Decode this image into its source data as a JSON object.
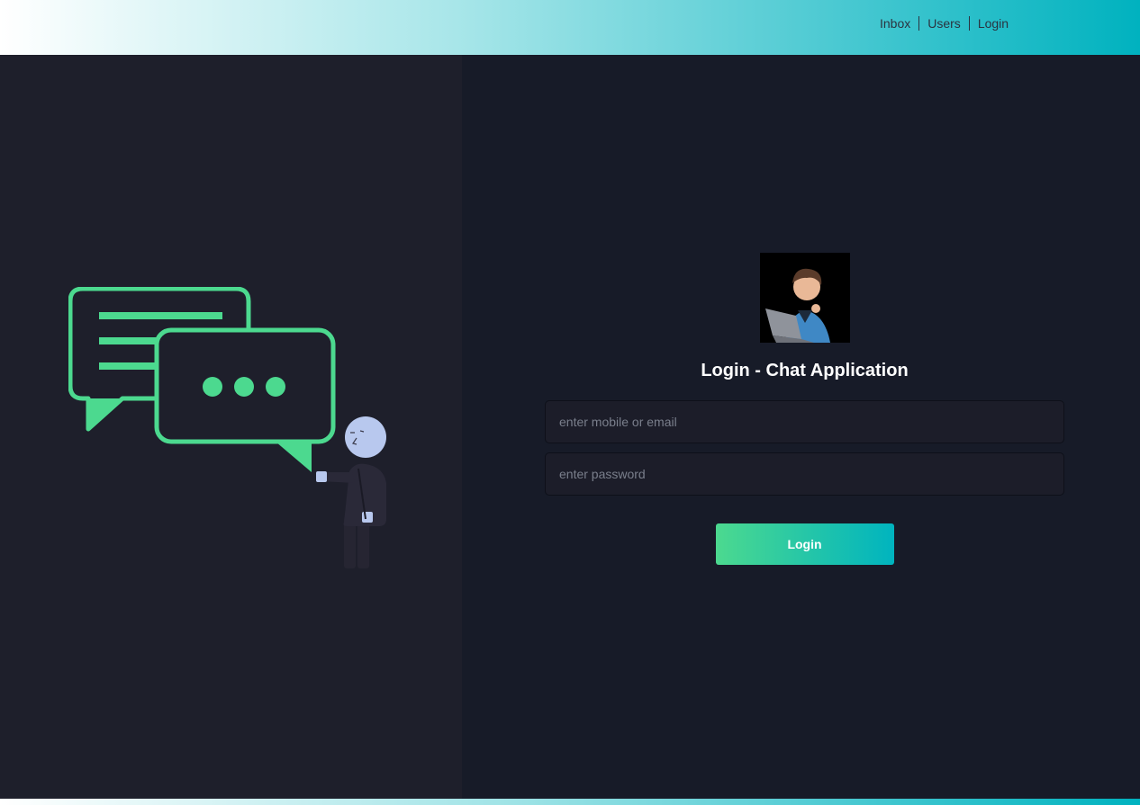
{
  "header": {
    "nav": [
      {
        "label": "Inbox"
      },
      {
        "label": "Users"
      },
      {
        "label": "Login"
      }
    ]
  },
  "login": {
    "title": "Login - Chat Application",
    "identifier_placeholder": "enter mobile or email",
    "password_placeholder": "enter password",
    "submit_label": "Login"
  },
  "colors": {
    "accent_green": "#4cd98f",
    "accent_teal": "#00b4bf",
    "left_bg": "#1e1f2b",
    "right_bg": "#171b28"
  }
}
